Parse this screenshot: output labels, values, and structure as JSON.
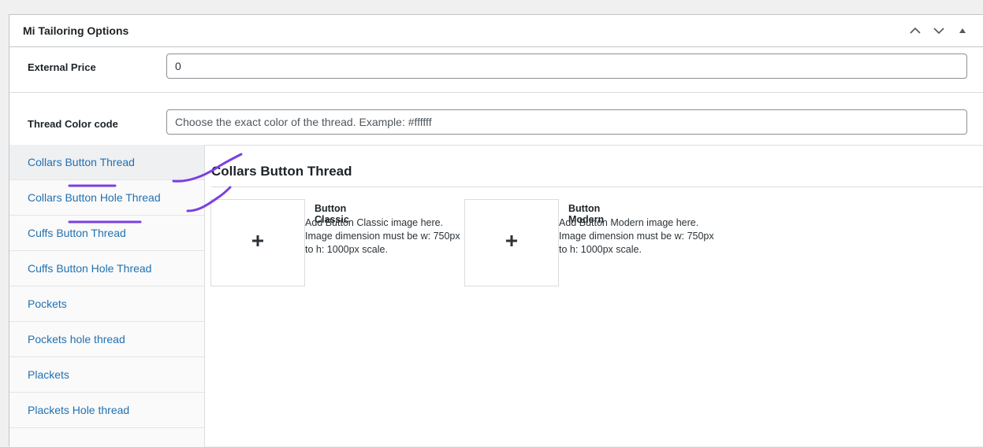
{
  "metabox": {
    "title": "Mi Tailoring Options",
    "controls": [
      "chevron-up-icon",
      "chevron-down-icon",
      "triangle-up-icon"
    ]
  },
  "fields": {
    "external_price": {
      "label": "External Price",
      "value": "0"
    },
    "thread_color": {
      "label": "Thread Color code",
      "value": "",
      "placeholder": "Choose the exact color of the thread. Example: #ffffff"
    }
  },
  "tabs": [
    {
      "label": "Collars Button Thread",
      "active": true
    },
    {
      "label": "Collars Button Hole Thread",
      "active": false
    },
    {
      "label": "Cuffs Button Thread",
      "active": false
    },
    {
      "label": "Cuffs Button Hole Thread",
      "active": false
    },
    {
      "label": "Pockets",
      "active": false
    },
    {
      "label": "Pockets hole thread",
      "active": false
    },
    {
      "label": "Plackets",
      "active": false
    },
    {
      "label": "Plackets Hole thread",
      "active": false
    }
  ],
  "content": {
    "title": "Collars Button Thread",
    "images": [
      {
        "name": "Button Classic",
        "description": "Add Button Classic image here. Image dimension must be w: 750px to h: 1000px scale.",
        "icon": "plus-icon"
      },
      {
        "name": "Button Modern",
        "description": "Add Button Modern image here. Image dimension must be w: 750px to h: 1000px scale.",
        "icon": "plus-icon"
      }
    ]
  },
  "colors": {
    "link": "#2271b1",
    "annotation": "#7b3fe4"
  }
}
